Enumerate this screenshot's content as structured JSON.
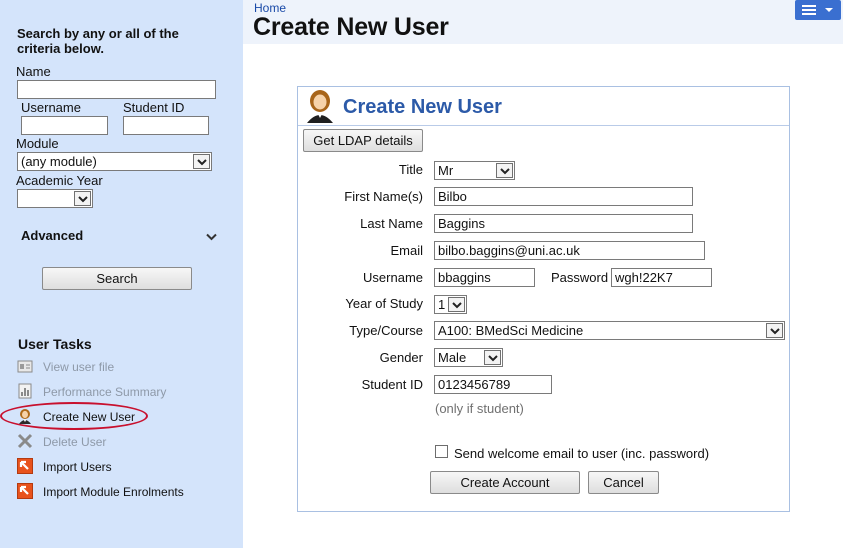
{
  "sidebar": {
    "heading": "Search by any or all of the criteria below.",
    "name_label": "Name",
    "name_value": "",
    "username_label": "Username",
    "username_value": "",
    "student_id_label": "Student ID",
    "student_id_value": "",
    "module_label": "Module",
    "module_value": "(any module)",
    "academic_year_label": "Academic Year",
    "academic_year_value": "",
    "advanced_label": "Advanced",
    "search_button": "Search",
    "tasks_title": "User Tasks",
    "tasks": [
      {
        "label": "View user file",
        "icon": "user-file-icon",
        "disabled": true
      },
      {
        "label": "Performance Summary",
        "icon": "chart-icon",
        "disabled": true
      },
      {
        "label": "Create New User",
        "icon": "user-icon",
        "disabled": false
      },
      {
        "label": "Delete User",
        "icon": "delete-x-icon",
        "disabled": true
      },
      {
        "label": "Import Users",
        "icon": "import-icon",
        "disabled": false
      },
      {
        "label": "Import Module Enrolments",
        "icon": "import-icon",
        "disabled": false
      }
    ]
  },
  "header": {
    "breadcrumb": "Home",
    "title": "Create New User"
  },
  "form": {
    "panel_title": "Create New User",
    "ldap_button": "Get LDAP details",
    "title_label": "Title",
    "title_value": "Mr",
    "first_name_label": "First Name(s)",
    "first_name_value": "Bilbo",
    "last_name_label": "Last Name",
    "last_name_value": "Baggins",
    "email_label": "Email",
    "email_value": "bilbo.baggins@uni.ac.uk",
    "username_label": "Username",
    "username_value": "bbaggins",
    "password_label": "Password",
    "password_value": "wgh!22K7",
    "year_label": "Year of Study",
    "year_value": "1",
    "type_label": "Type/Course",
    "type_value": "A100: BMedSci Medicine",
    "gender_label": "Gender",
    "gender_value": "Male",
    "student_id_label": "Student ID",
    "student_id_value": "0123456789",
    "student_id_hint": "(only if student)",
    "welcome_label": "Send welcome email to user (inc. password)",
    "welcome_checked": false,
    "create_button": "Create Account",
    "cancel_button": "Cancel"
  },
  "colors": {
    "sidebar_bg": "#d4e4fb",
    "title_blue": "#2c5aa8",
    "highlight_red": "#c8102e",
    "menu_blue": "#3a6fd0"
  }
}
